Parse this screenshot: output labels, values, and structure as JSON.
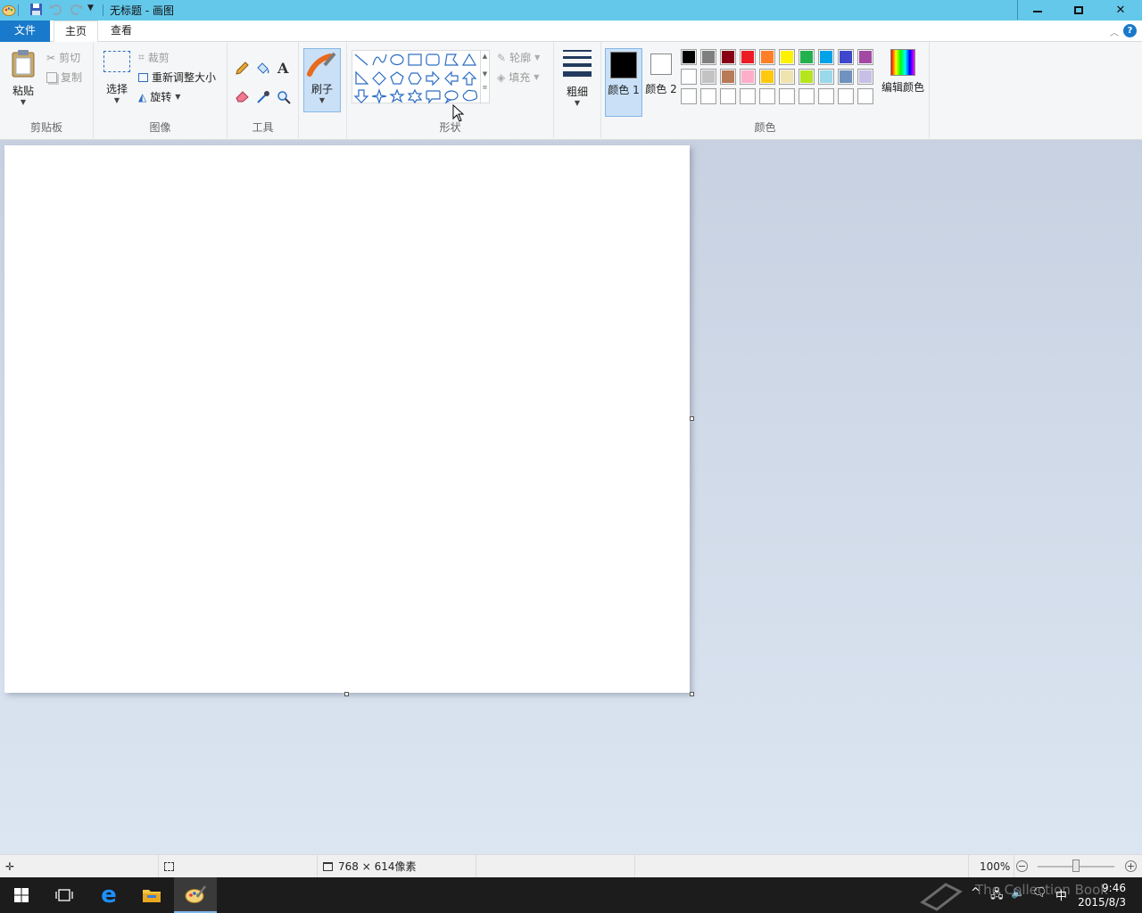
{
  "window": {
    "title": "无标题 - 画图",
    "minimize": "🗕",
    "maximize": "🗗",
    "close": "✕"
  },
  "tabs": {
    "file": "文件",
    "home": "主页",
    "view": "查看"
  },
  "clipboard": {
    "paste": "粘贴",
    "cut": "剪切",
    "copy": "复制",
    "label": "剪贴板"
  },
  "image": {
    "select": "选择",
    "crop": "裁剪",
    "resize": "重新调整大小",
    "rotate": "旋转",
    "label": "图像"
  },
  "tools": {
    "label": "工具",
    "text_glyph": "A"
  },
  "brushes": {
    "label": "刷子"
  },
  "shapes": {
    "outline": "轮廓",
    "fill": "填充",
    "label": "形状"
  },
  "size": {
    "label": "粗细"
  },
  "colors": {
    "color1": "颜色 1",
    "color2": "颜色 2",
    "edit": "编辑颜色",
    "label": "颜色",
    "color1_value": "#000000",
    "color2_value": "#ffffff",
    "palette_row1": [
      "#000000",
      "#7f7f7f",
      "#880015",
      "#ed1c24",
      "#ff7f27",
      "#fff200",
      "#22b14c",
      "#00a2e8",
      "#3f48cc",
      "#a349a4"
    ],
    "palette_row2": [
      "#ffffff",
      "#c3c3c3",
      "#b97a57",
      "#ffaec9",
      "#ffc90e",
      "#efe4b0",
      "#b5e61d",
      "#99d9ea",
      "#7092be",
      "#c8bfe7"
    ],
    "palette_row3": [
      "#ffffff",
      "#ffffff",
      "#ffffff",
      "#ffffff",
      "#ffffff",
      "#ffffff",
      "#ffffff",
      "#ffffff",
      "#ffffff",
      "#ffffff"
    ]
  },
  "status": {
    "dimensions": "768 × 614像素",
    "zoom": "100%"
  },
  "taskbar": {
    "time": "9:46",
    "date": "2015/8/3",
    "ime": "中",
    "watermark": "The Collection Book"
  }
}
